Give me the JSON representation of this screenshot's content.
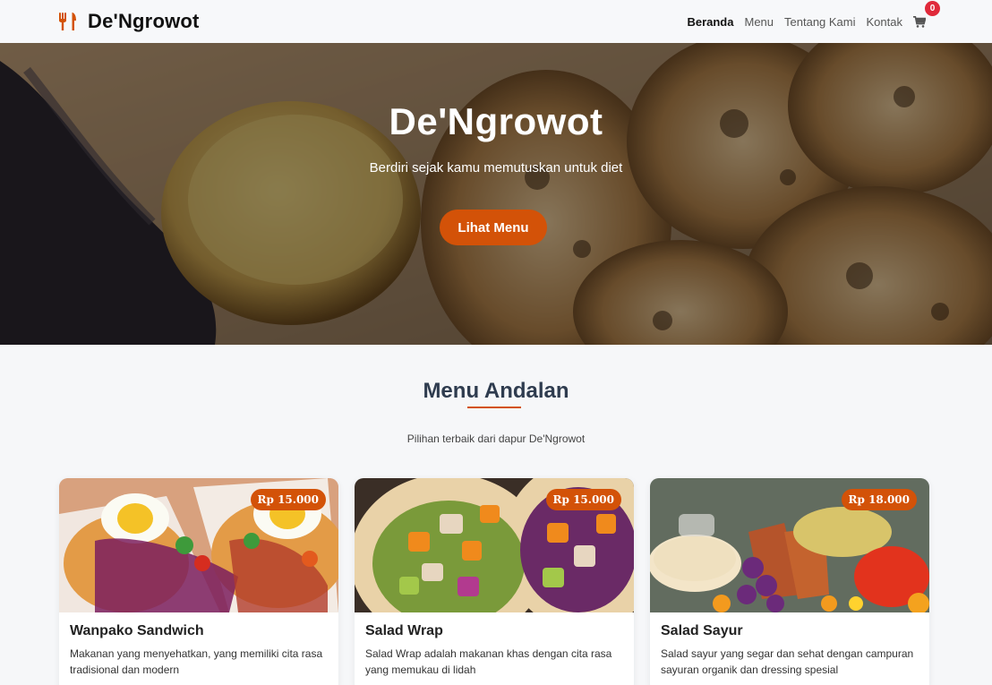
{
  "brand": {
    "name": "De'Ngrowot",
    "icon": "utensils-icon"
  },
  "nav": {
    "items": [
      {
        "label": "Beranda",
        "active": true
      },
      {
        "label": "Menu",
        "active": false
      },
      {
        "label": "Tentang Kami",
        "active": false
      },
      {
        "label": "Kontak",
        "active": false
      }
    ],
    "cart_icon": "cart-icon",
    "cart_count": "0"
  },
  "hero": {
    "title": "De'Ngrowot",
    "subtitle": "Berdiri sejak kamu memutuskan untuk diet",
    "cta_label": "Lihat Menu"
  },
  "featured": {
    "title": "Menu Andalan",
    "subtitle": "Pilihan terbaik dari dapur De'Ngrowot",
    "items": [
      {
        "name": "Wanpako Sandwich",
        "price": "Rp 15.000",
        "description": "Makanan yang menyehatkan, yang memiliki cita rasa tradisional dan modern"
      },
      {
        "name": "Salad Wrap",
        "price": "Rp 15.000",
        "description": "Salad Wrap adalah makanan khas dengan cita rasa yang memukau di lidah"
      },
      {
        "name": "Salad Sayur",
        "price": "Rp 18.000",
        "description": "Salad sayur yang segar dan sehat dengan campuran sayuran organik dan dressing spesial"
      }
    ]
  },
  "colors": {
    "accent": "#d35208",
    "badge": "#e0293a",
    "heading": "#2f3c4f"
  }
}
